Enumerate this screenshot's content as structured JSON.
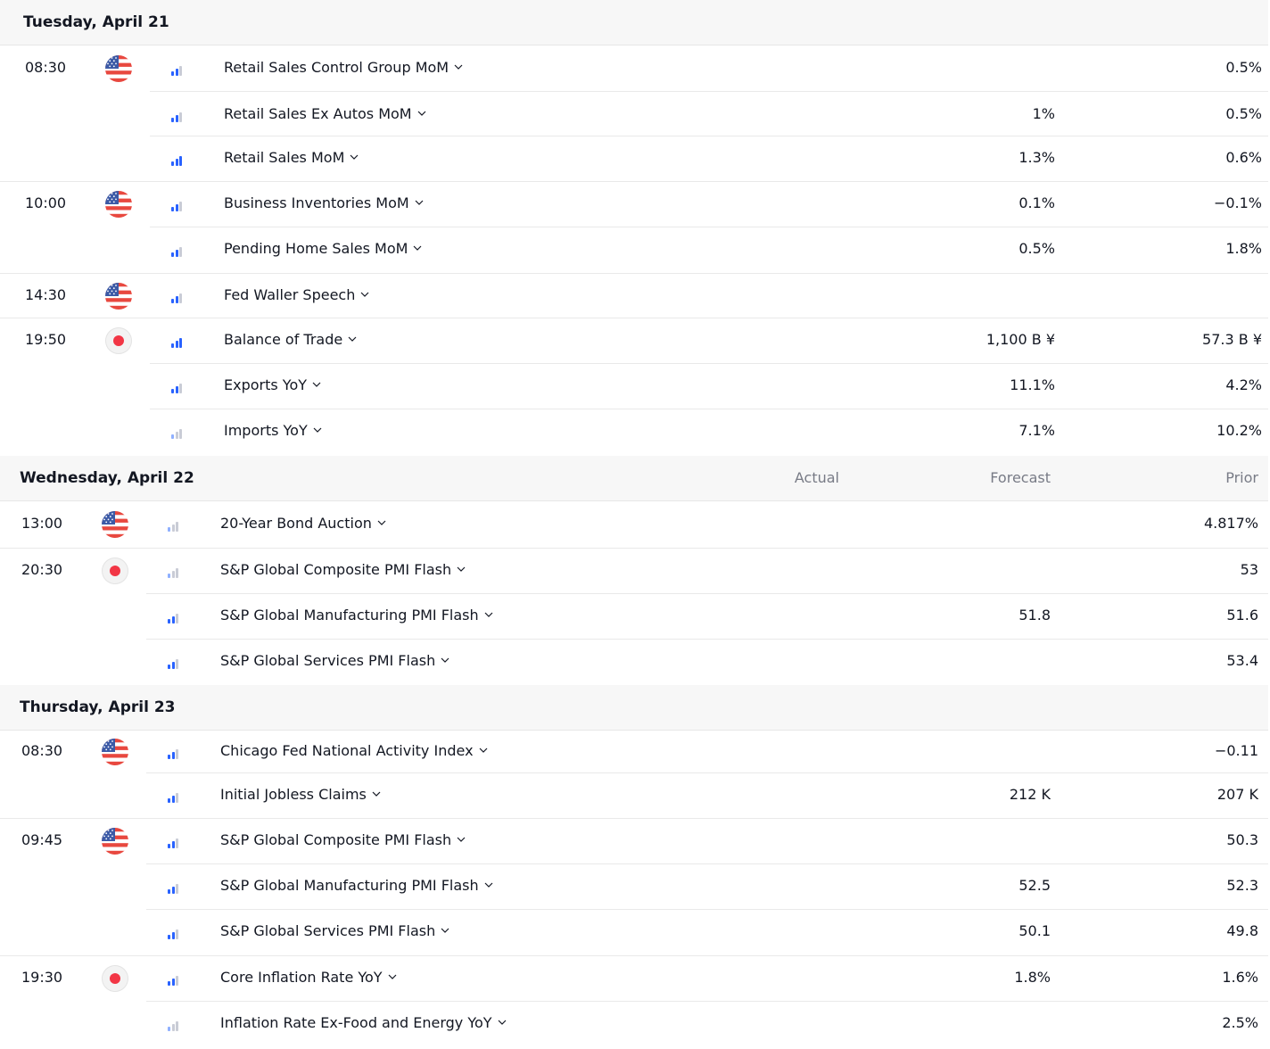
{
  "columns": {
    "actual": "Actual",
    "forecast": "Forecast",
    "prior": "Prior"
  },
  "days": [
    {
      "title": "Tuesday, April 21",
      "show_columns": false,
      "events": [
        {
          "time": "08:30",
          "flag": "us-flag",
          "importance": 2,
          "name": "Retail Sales Control Group MoM",
          "actual": "",
          "forecast": "",
          "prior": "0.5%"
        },
        {
          "time": "",
          "flag": "",
          "importance": 2,
          "name": "Retail Sales Ex Autos MoM",
          "actual": "",
          "forecast": "1%",
          "prior": "0.5%"
        },
        {
          "time": "",
          "flag": "",
          "importance": 3,
          "name": "Retail Sales MoM",
          "actual": "",
          "forecast": "1.3%",
          "prior": "0.6%"
        },
        {
          "time": "10:00",
          "flag": "us-flag",
          "importance": 2,
          "name": "Business Inventories MoM",
          "actual": "",
          "forecast": "0.1%",
          "prior": "−0.1%"
        },
        {
          "time": "",
          "flag": "",
          "importance": 2,
          "name": "Pending Home Sales MoM",
          "actual": "",
          "forecast": "0.5%",
          "prior": "1.8%"
        },
        {
          "time": "14:30",
          "flag": "us-flag",
          "importance": 2,
          "name": "Fed Waller Speech",
          "actual": "",
          "forecast": "",
          "prior": ""
        },
        {
          "time": "19:50",
          "flag": "japan-flag",
          "importance": 3,
          "name": "Balance of Trade",
          "actual": "",
          "forecast": "1,100 B ¥",
          "prior": "57.3 B ¥"
        },
        {
          "time": "",
          "flag": "",
          "importance": 2,
          "name": "Exports YoY",
          "actual": "",
          "forecast": "11.1%",
          "prior": "4.2%"
        },
        {
          "time": "",
          "flag": "",
          "importance": 1,
          "name": "Imports YoY",
          "actual": "",
          "forecast": "7.1%",
          "prior": "10.2%"
        }
      ]
    },
    {
      "title": "Wednesday, April 22",
      "show_columns": true,
      "events": [
        {
          "time": "13:00",
          "flag": "us-flag",
          "importance": 1,
          "name": "20-Year Bond Auction",
          "actual": "",
          "forecast": "",
          "prior": "4.817%"
        },
        {
          "time": "20:30",
          "flag": "japan-flag",
          "importance": 1,
          "name": "S&P Global Composite PMI Flash",
          "actual": "",
          "forecast": "",
          "prior": "53"
        },
        {
          "time": "",
          "flag": "",
          "importance": 2,
          "name": "S&P Global Manufacturing PMI Flash",
          "actual": "",
          "forecast": "51.8",
          "prior": "51.6"
        },
        {
          "time": "",
          "flag": "",
          "importance": 2,
          "name": "S&P Global Services PMI Flash",
          "actual": "",
          "forecast": "",
          "prior": "53.4"
        }
      ]
    },
    {
      "title": "Thursday, April 23",
      "show_columns": false,
      "events": [
        {
          "time": "08:30",
          "flag": "us-flag",
          "importance": 2,
          "name": "Chicago Fed National Activity Index",
          "actual": "",
          "forecast": "",
          "prior": "−0.11"
        },
        {
          "time": "",
          "flag": "",
          "importance": 2,
          "name": "Initial Jobless Claims",
          "actual": "",
          "forecast": "212 K",
          "prior": "207 K"
        },
        {
          "time": "09:45",
          "flag": "us-flag",
          "importance": 2,
          "name": "S&P Global Composite PMI Flash",
          "actual": "",
          "forecast": "",
          "prior": "50.3"
        },
        {
          "time": "",
          "flag": "",
          "importance": 2,
          "name": "S&P Global Manufacturing PMI Flash",
          "actual": "",
          "forecast": "52.5",
          "prior": "52.3"
        },
        {
          "time": "",
          "flag": "",
          "importance": 2,
          "name": "S&P Global Services PMI Flash",
          "actual": "",
          "forecast": "50.1",
          "prior": "49.8"
        },
        {
          "time": "19:30",
          "flag": "japan-flag",
          "importance": 2,
          "name": "Core Inflation Rate YoY",
          "actual": "",
          "forecast": "1.8%",
          "prior": "1.6%"
        },
        {
          "time": "",
          "flag": "",
          "importance": 1,
          "name": "Inflation Rate Ex-Food and Energy YoY",
          "actual": "",
          "forecast": "",
          "prior": "2.5%"
        }
      ]
    }
  ],
  "colors": {
    "accent": "#2962ff",
    "muted_bar": "#c9ccd6",
    "header_bg": "#f7f7f7"
  }
}
